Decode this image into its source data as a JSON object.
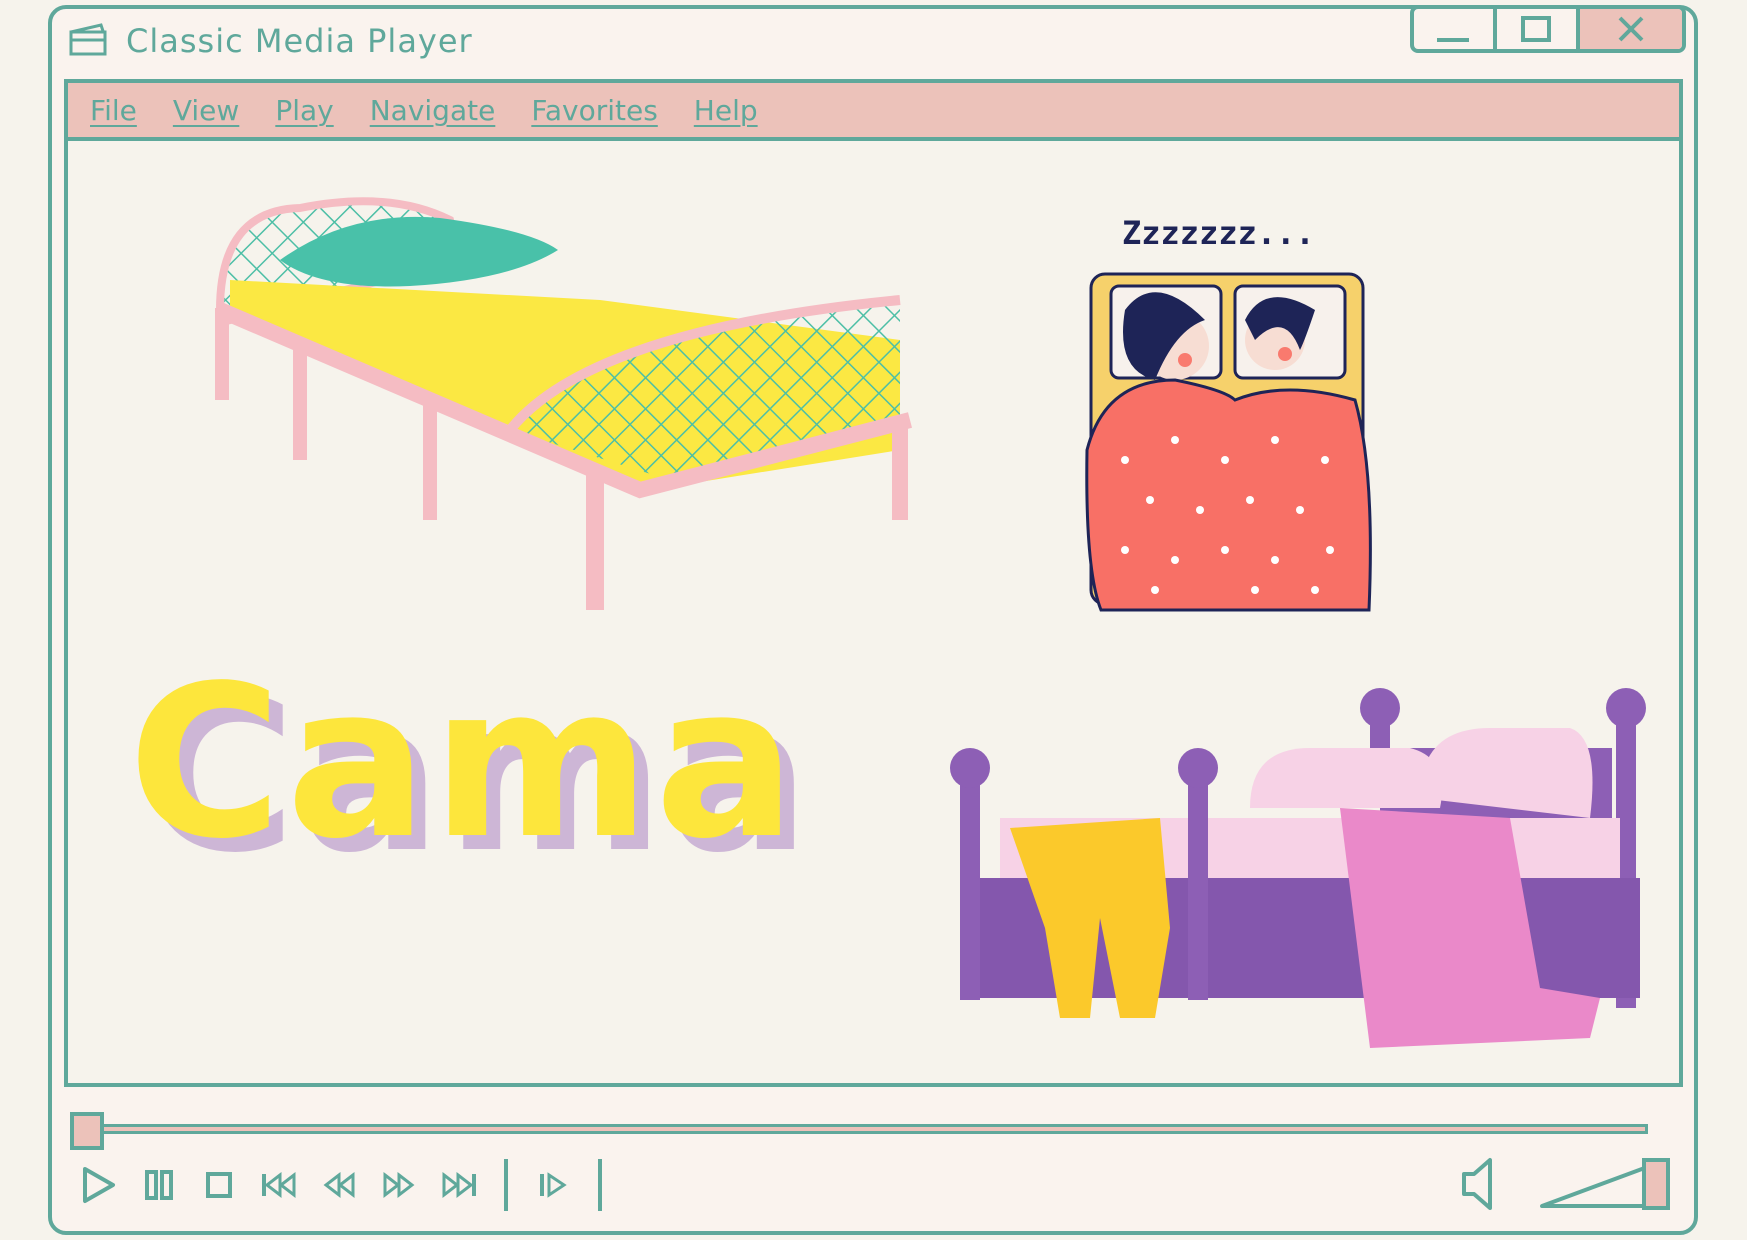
{
  "window": {
    "title": "Classic Media Player",
    "controls": {
      "minimize_icon": "minimize-icon",
      "maximize_icon": "maximize-icon",
      "close_icon": "close-icon"
    }
  },
  "menu": {
    "items": [
      {
        "label": "File"
      },
      {
        "label": "View"
      },
      {
        "label": "Play"
      },
      {
        "label": "Navigate"
      },
      {
        "label": "Favorites"
      },
      {
        "label": "Help"
      }
    ]
  },
  "content": {
    "word": "Cama",
    "sleep_text": "Zzzzzzz..."
  },
  "playback": {
    "position_fraction": 0.0,
    "volume_fraction": 1.0,
    "buttons": [
      "play-icon",
      "pause-icon",
      "stop-icon",
      "skip-back-icon",
      "rewind-icon",
      "fast-forward-icon",
      "skip-forward-icon",
      "frame-step-icon"
    ]
  },
  "colors": {
    "accent": "#5fa89b",
    "menu_bg": "#ecc2ba",
    "word": "#fde63c",
    "word_shadow": "#cdb6d6"
  }
}
